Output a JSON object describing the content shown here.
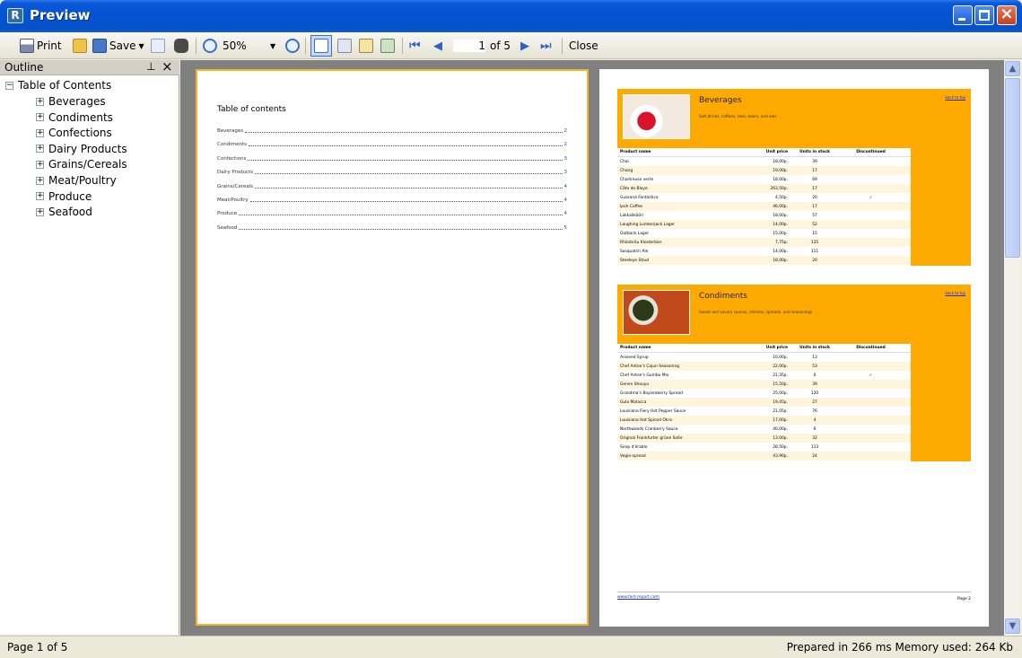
{
  "window": {
    "title": "Preview",
    "icon_letter": "R"
  },
  "toolbar": {
    "print_label": "Print",
    "save_label": "Save",
    "zoom_value": "50%",
    "page_current": "1",
    "page_of": "of 5",
    "close_label": "Close"
  },
  "outline": {
    "title": "Outline",
    "pin_glyph": "⊥",
    "close_glyph": "×",
    "root": "Table of Contents",
    "items": [
      "Beverages",
      "Condiments",
      "Confections",
      "Dairy Products",
      "Grains/Cereals",
      "Meat/Poultry",
      "Produce",
      "Seafood"
    ]
  },
  "page1": {
    "toc_title": "Table of contents",
    "rows": [
      {
        "name": "Beverages",
        "page": "2"
      },
      {
        "name": "Condiments",
        "page": "2"
      },
      {
        "name": "Confections",
        "page": "3"
      },
      {
        "name": "Dairy Products",
        "page": "3"
      },
      {
        "name": "Grains/Cereals",
        "page": "4"
      },
      {
        "name": "Meat/Poultry",
        "page": "4"
      },
      {
        "name": "Produce",
        "page": "4"
      },
      {
        "name": "Seafood",
        "page": "5"
      }
    ]
  },
  "page2": {
    "back_to_top": "back to top",
    "headers": {
      "name": "Product name",
      "price": "Unit price",
      "stock": "Units in stock",
      "disc": "Discontinued"
    },
    "beverages": {
      "name": "Beverages",
      "desc": "Soft drinks, coffees, teas, beers, and ales",
      "rows": [
        [
          "Chai",
          "18,00p.",
          "39",
          ""
        ],
        [
          "Chang",
          "19,00p.",
          "17",
          ""
        ],
        [
          "Chartreuse verte",
          "18,00p.",
          "69",
          ""
        ],
        [
          "Côte de Blaye",
          "263,50p.",
          "17",
          ""
        ],
        [
          "Guaraná Fantástica",
          "4,50p.",
          "20",
          "✓"
        ],
        [
          "Ipoh Coffee",
          "46,00p.",
          "17",
          ""
        ],
        [
          "Lakkalikööri",
          "18,00p.",
          "57",
          ""
        ],
        [
          "Laughing Lumberjack Lager",
          "14,00p.",
          "52",
          ""
        ],
        [
          "Outback Lager",
          "15,00p.",
          "15",
          ""
        ],
        [
          "Rhönbräu Klosterbier",
          "7,75p.",
          "125",
          ""
        ],
        [
          "Sasquatch Ale",
          "14,00p.",
          "111",
          ""
        ],
        [
          "Steeleye Stout",
          "18,00p.",
          "20",
          ""
        ]
      ]
    },
    "condiments": {
      "name": "Condiments",
      "desc": "Sweet and savory sauces, relishes, spreads, and seasonings",
      "rows": [
        [
          "Aniseed Syrup",
          "10,00p.",
          "13",
          ""
        ],
        [
          "Chef Anton's Cajun Seasoning",
          "22,00p.",
          "53",
          ""
        ],
        [
          "Chef Anton's Gumbo Mix",
          "21,35p.",
          "0",
          "✓"
        ],
        [
          "Genen Shouyu",
          "15,50p.",
          "39",
          ""
        ],
        [
          "Grandma's Boysenberry Spread",
          "25,00p.",
          "120",
          ""
        ],
        [
          "Gula Malacca",
          "19,45p.",
          "27",
          ""
        ],
        [
          "Louisiana Fiery Hot Pepper Sauce",
          "21,05p.",
          "76",
          ""
        ],
        [
          "Louisiana Hot Spiced Okra",
          "17,00p.",
          "4",
          ""
        ],
        [
          "Northwoods Cranberry Sauce",
          "40,00p.",
          "6",
          ""
        ],
        [
          "Original Frankfurter grüne Soße",
          "13,00p.",
          "32",
          ""
        ],
        [
          "Sirop d'érable",
          "28,50p.",
          "113",
          ""
        ],
        [
          "Vegie-spread",
          "43,90p.",
          "24",
          ""
        ]
      ]
    },
    "footer_link": "www.fast-report.com",
    "footer_page": "Page 2"
  },
  "status": {
    "page": "Page 1 of 5",
    "right": "Prepared in 266 ms   Memory used: 264 Kb"
  }
}
